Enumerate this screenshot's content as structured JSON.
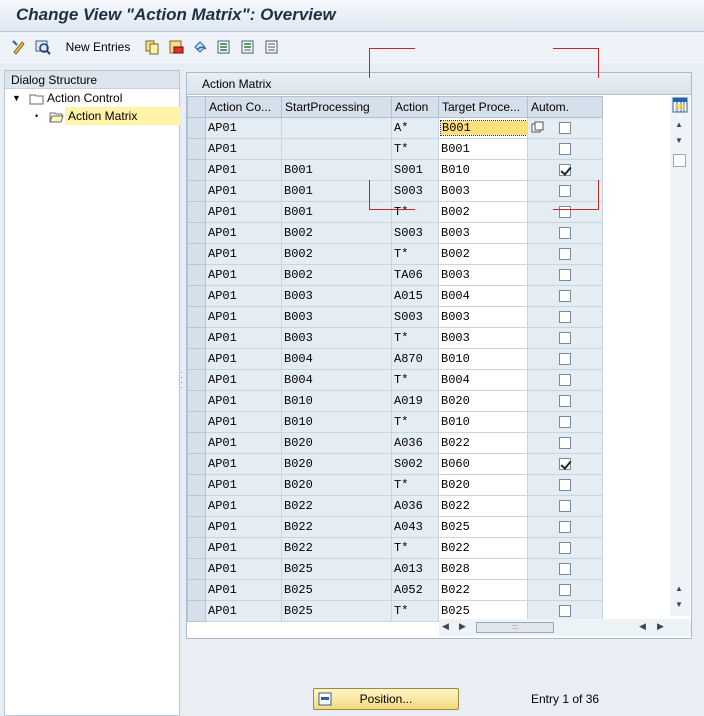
{
  "window": {
    "title": "Change View \"Action Matrix\": Overview"
  },
  "toolbar": {
    "new_entries_label": "New Entries"
  },
  "left_panel": {
    "header": "Dialog Structure",
    "tree": [
      {
        "label": "Action Control",
        "expanded": true
      },
      {
        "label": "Action Matrix",
        "selected": true
      }
    ]
  },
  "table": {
    "title": "Action Matrix",
    "columns": [
      "Action Co...",
      "StartProcessing",
      "Action",
      "Target Proce...",
      "Autom."
    ],
    "rows": [
      [
        "AP01",
        "",
        "A*",
        "B001",
        false
      ],
      [
        "AP01",
        "",
        "T*",
        "B001",
        false
      ],
      [
        "AP01",
        "B001",
        "S001",
        "B010",
        true
      ],
      [
        "AP01",
        "B001",
        "S003",
        "B003",
        false
      ],
      [
        "AP01",
        "B001",
        "T*",
        "B002",
        false
      ],
      [
        "AP01",
        "B002",
        "S003",
        "B003",
        false
      ],
      [
        "AP01",
        "B002",
        "T*",
        "B002",
        false
      ],
      [
        "AP01",
        "B002",
        "TA06",
        "B003",
        false
      ],
      [
        "AP01",
        "B003",
        "A015",
        "B004",
        false
      ],
      [
        "AP01",
        "B003",
        "S003",
        "B003",
        false
      ],
      [
        "AP01",
        "B003",
        "T*",
        "B003",
        false
      ],
      [
        "AP01",
        "B004",
        "A870",
        "B010",
        false
      ],
      [
        "AP01",
        "B004",
        "T*",
        "B004",
        false
      ],
      [
        "AP01",
        "B010",
        "A019",
        "B020",
        false
      ],
      [
        "AP01",
        "B010",
        "T*",
        "B010",
        false
      ],
      [
        "AP01",
        "B020",
        "A036",
        "B022",
        false
      ],
      [
        "AP01",
        "B020",
        "S002",
        "B060",
        true
      ],
      [
        "AP01",
        "B020",
        "T*",
        "B020",
        false
      ],
      [
        "AP01",
        "B022",
        "A036",
        "B022",
        false
      ],
      [
        "AP01",
        "B022",
        "A043",
        "B025",
        false
      ],
      [
        "AP01",
        "B022",
        "T*",
        "B022",
        false
      ],
      [
        "AP01",
        "B025",
        "A013",
        "B028",
        false
      ],
      [
        "AP01",
        "B025",
        "A052",
        "B022",
        false
      ],
      [
        "AP01",
        "B025",
        "T*",
        "B025",
        false
      ]
    ]
  },
  "footer": {
    "position_button": "Position...",
    "entry_info": "Entry 1 of 36"
  },
  "colors": {
    "accent": "#c8242a",
    "header_bg": "#d5e0ea",
    "row_bg": "#e4ecf4"
  }
}
